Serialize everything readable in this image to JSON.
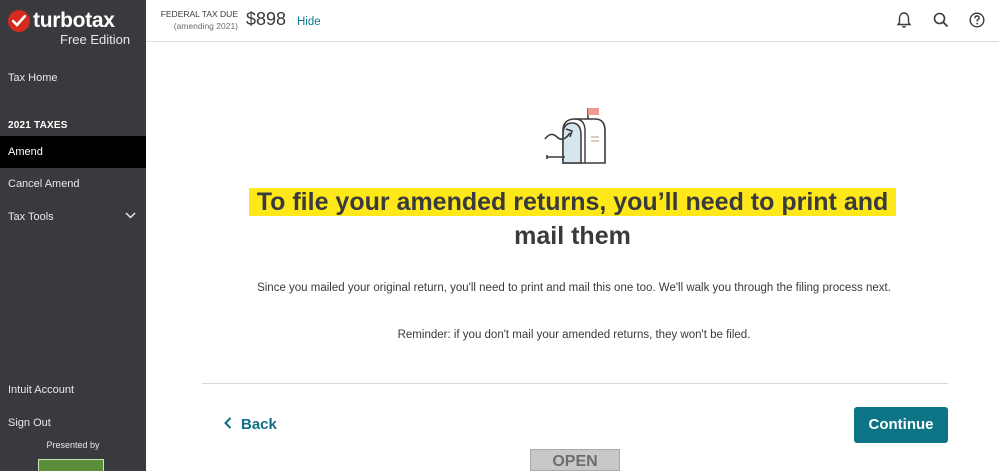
{
  "brand": {
    "name": "turbotax",
    "edition": "Free Edition"
  },
  "sidebar": {
    "tax_home": "Tax Home",
    "section_heading": "2021 TAXES",
    "items": [
      {
        "label": "Amend"
      },
      {
        "label": "Cancel Amend"
      },
      {
        "label": "Tax Tools"
      }
    ],
    "intuit_account": "Intuit Account",
    "sign_out": "Sign Out",
    "presented_by": "Presented by"
  },
  "header": {
    "due_label": "FEDERAL TAX DUE",
    "due_sub": "(amending 2021)",
    "due_amount": "$898",
    "hide_label": "Hide",
    "icons": [
      "bell-icon",
      "search-icon",
      "help-icon"
    ]
  },
  "main": {
    "headline_line1": "To file your amended returns, you’ll need to print and",
    "headline_line2": "mail them",
    "body": "Since you mailed your original return, you'll need to print and mail this one too. We'll walk you through the filing process next.",
    "reminder": "Reminder: if you don't mail your amended returns, they won't be filed.",
    "back_label": "Back",
    "continue_label": "Continue",
    "open_badge": "OPEN"
  },
  "colors": {
    "sidebar_bg": "#393a3d",
    "active_bg": "#000000",
    "accent_teal": "#0d7485",
    "highlight": "#ffe81a",
    "brand_red": "#d52b1e"
  }
}
